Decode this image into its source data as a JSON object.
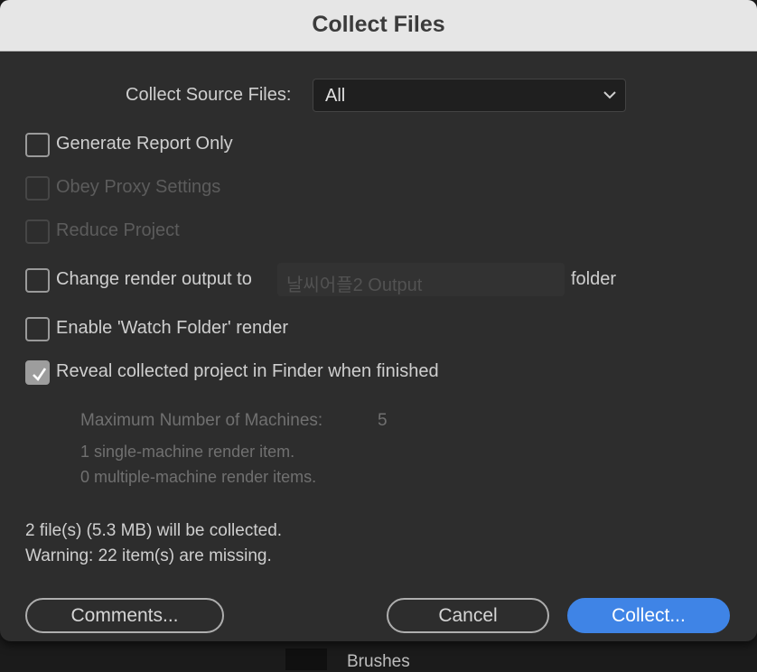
{
  "dialog": {
    "title": "Collect Files"
  },
  "collect_source": {
    "label": "Collect Source Files:",
    "value": "All"
  },
  "options": {
    "generate_report": {
      "label": "Generate Report Only",
      "checked": false,
      "enabled": true
    },
    "obey_proxy": {
      "label": "Obey Proxy Settings",
      "checked": false,
      "enabled": false
    },
    "reduce_project": {
      "label": "Reduce Project",
      "checked": false,
      "enabled": false
    },
    "change_render": {
      "label": "Change render output to",
      "folder_value": "날씨어플2 Output",
      "suffix": "folder",
      "checked": false,
      "enabled": true
    },
    "watch_folder": {
      "label": "Enable 'Watch Folder' render",
      "checked": false,
      "enabled": true
    },
    "reveal": {
      "label": "Reveal collected project in Finder when finished",
      "checked": true,
      "enabled": true
    }
  },
  "watch": {
    "max_machines_label": "Maximum Number of Machines:",
    "max_machines_value": "5",
    "single_items": "1 single-machine render item.",
    "multiple_items": "0 multiple-machine render items."
  },
  "summary": {
    "files": "2 file(s) (5.3 MB) will be collected.",
    "warning": "Warning: 22 item(s) are missing."
  },
  "buttons": {
    "comments": "Comments...",
    "cancel": "Cancel",
    "collect": "Collect..."
  },
  "background": {
    "label": "Brushes"
  },
  "colors": {
    "accent": "#3f84e6",
    "dialog_bg": "#2d2d2d",
    "titlebar_bg": "#e6e6e6"
  }
}
